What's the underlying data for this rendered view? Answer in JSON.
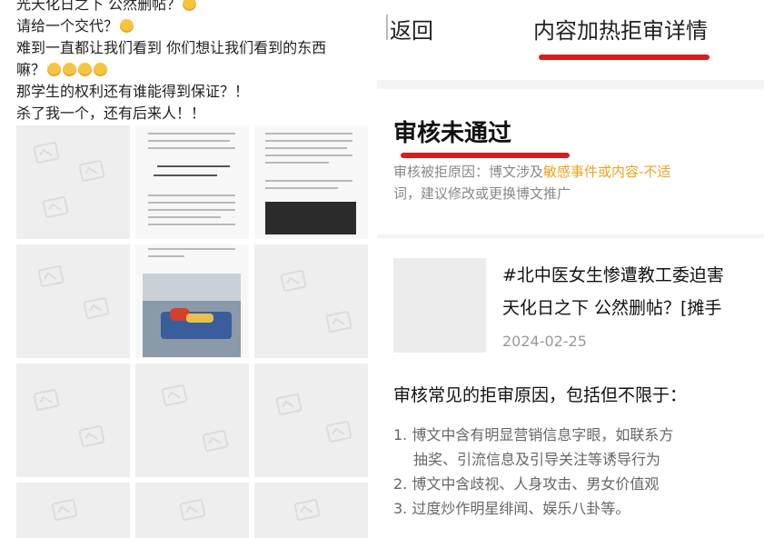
{
  "left_post": {
    "lines": [
      "光天化日之下 公然删帖？",
      "请给一个交代？",
      "难到一直都让我们看到 你们想让我们看到的东西",
      "嘛？",
      "那学生的权利还有谁能得到保证？！",
      "杀了我一个，还有后来人！！"
    ]
  },
  "header": {
    "back_label": "返回",
    "title": "内容加热拒审详情"
  },
  "status": {
    "title": "审核未通过",
    "reason_prefix": "审核被拒原因：博文涉及",
    "reason_highlight": "敏感事件或内容-不适",
    "reason_line2": "词，建议修改或更换博文推广"
  },
  "post": {
    "title_line1": "#北中医女生惨遭教工委迫害",
    "title_line2": "天化日之下 公然删帖？[摊手",
    "date": "2024-02-25"
  },
  "common_reasons": {
    "heading": "审核常见的拒审原因，包括但不限于：",
    "items": [
      "1. 博文中含有明显营销信息字眼，如联系方",
      "抽奖、引流信息及引导关注等诱导行为",
      "2. 博文中含歧视、人身攻击、男女价值观",
      "3. 过度炒作明星绯闻、娱乐八卦等。"
    ]
  },
  "colors": {
    "annotation_red": "#d21f1f",
    "highlight_orange": "#f0a020"
  }
}
